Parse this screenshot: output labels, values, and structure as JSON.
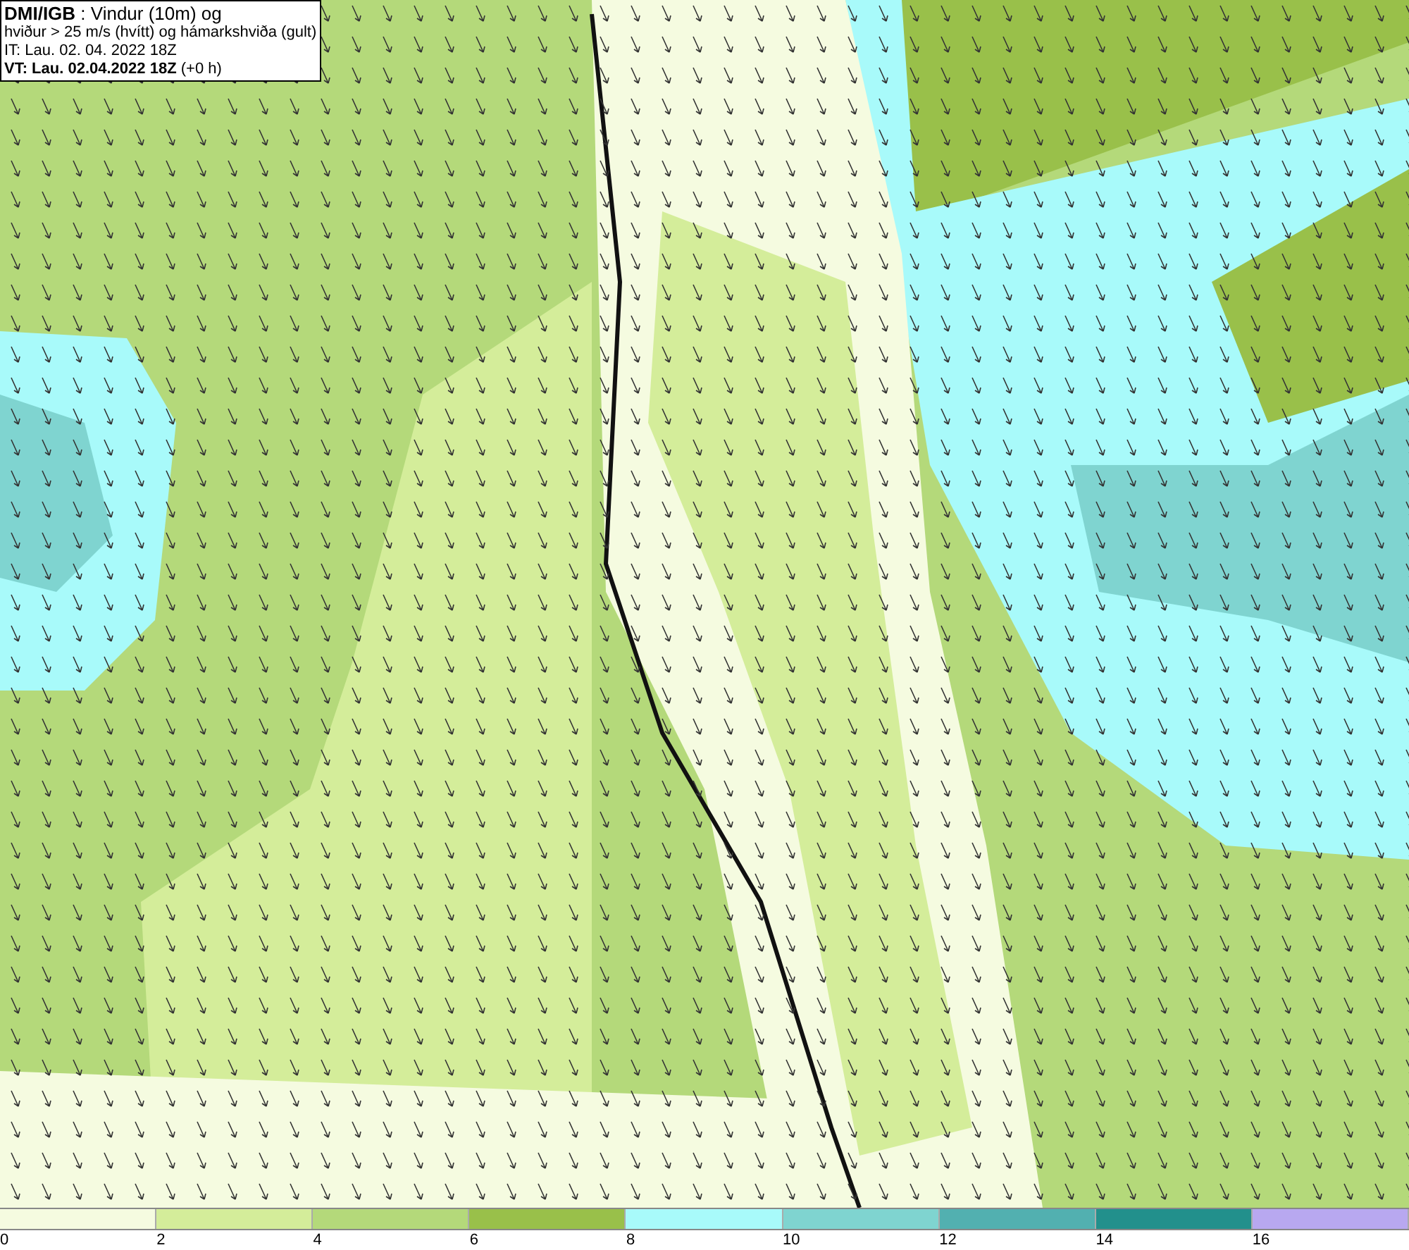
{
  "header": {
    "lines": [
      "**DMI/IGB** : Vindur (10m) og",
      "hviður > 25 m/s (hvítt) og hámarkshviða (gult)",
      "IT: Lau. 02. 04. 2022 18Z",
      "**VT: Lau. 02.04.2022 18Z** (+0 h)"
    ]
  },
  "legend": {
    "bins": [
      {
        "color": "#f5fbe0"
      },
      {
        "color": "#d4ed9a"
      },
      {
        "color": "#b4d97a"
      },
      {
        "color": "#99c04a"
      },
      {
        "color": "#a8fafa"
      },
      {
        "color": "#7fd4d0"
      },
      {
        "color": "#52b0b0"
      },
      {
        "color": "#22908c"
      },
      {
        "color": "#b8a8f0"
      }
    ],
    "labels": [
      "0",
      "2",
      "4",
      "6",
      "8",
      "10",
      "12",
      "14",
      "16"
    ]
  }
}
